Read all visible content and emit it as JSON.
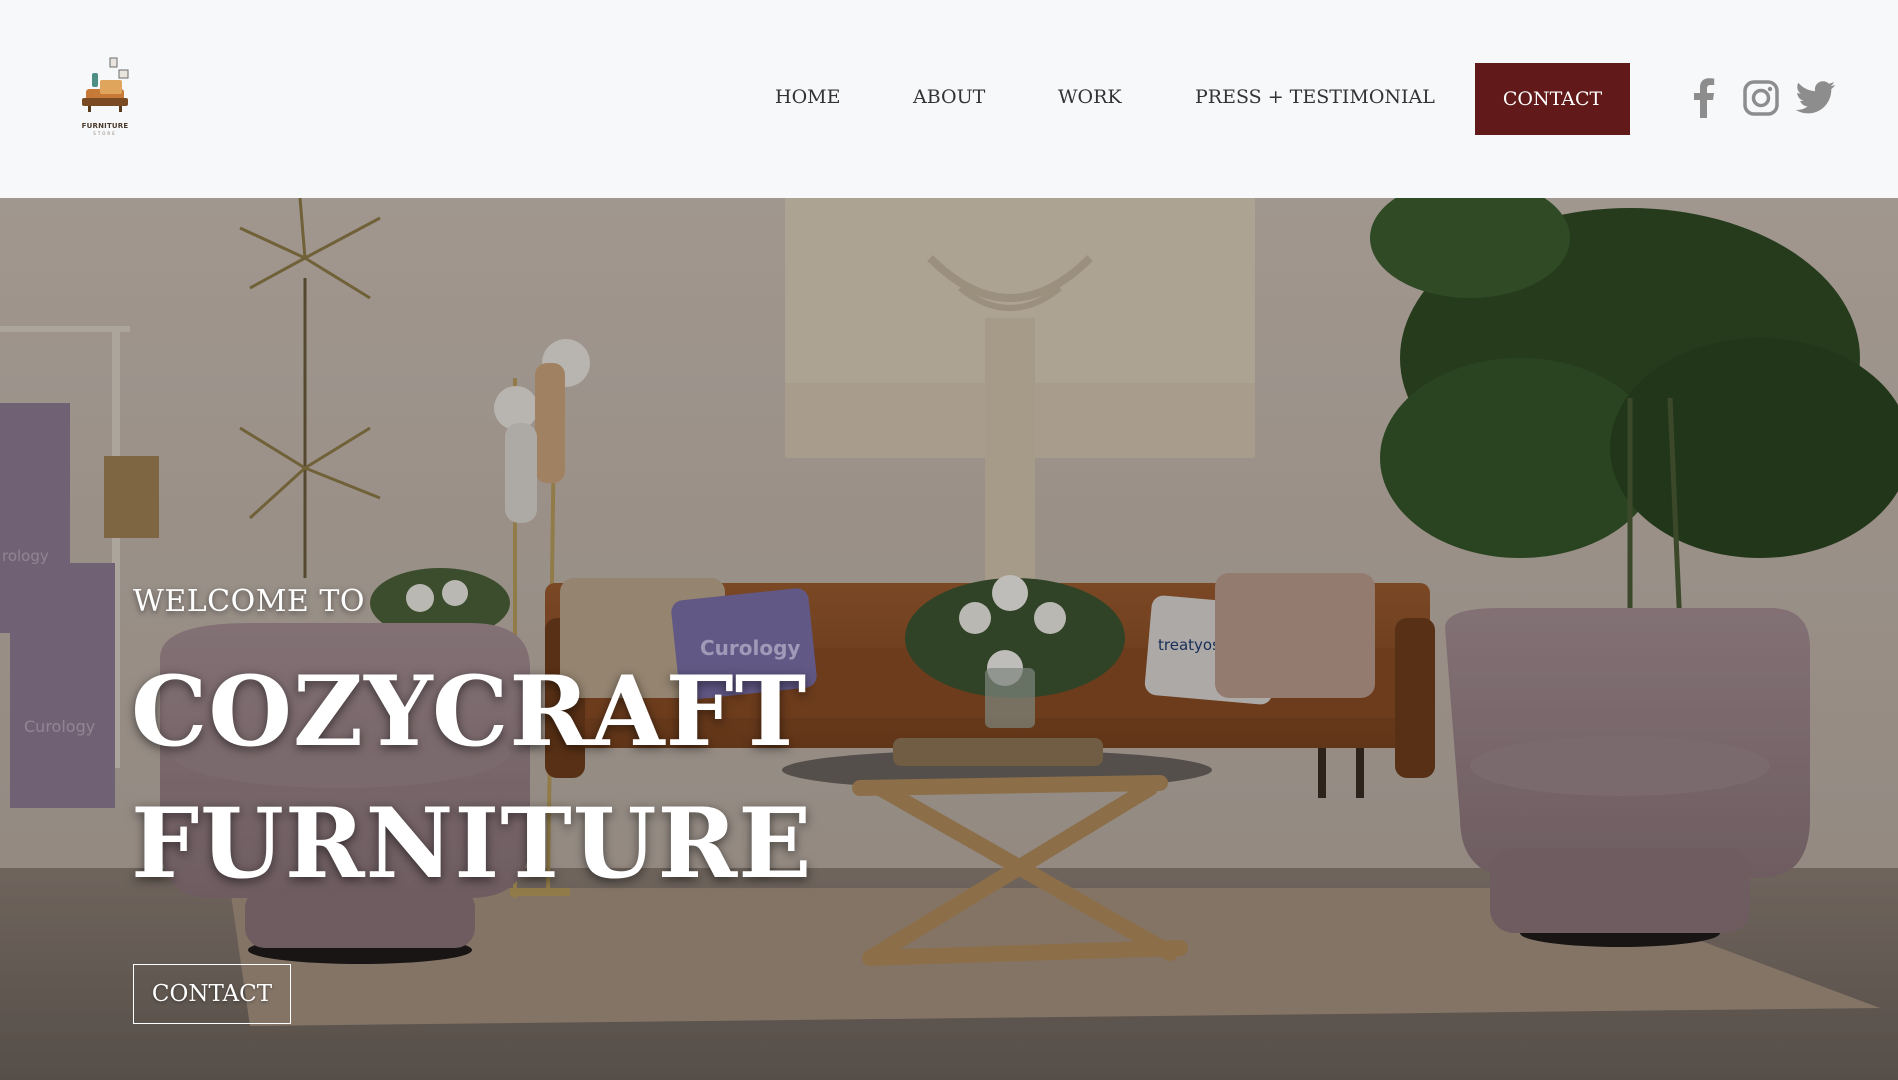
{
  "brand": {
    "logo_text": "FURNITURE",
    "logo_subtext": "STORE"
  },
  "nav": {
    "items": [
      {
        "label": "HOME"
      },
      {
        "label": "ABOUT"
      },
      {
        "label": "WORK"
      },
      {
        "label": "PRESS + TESTIMONIAL"
      }
    ],
    "contact_label": "CONTACT"
  },
  "social": {
    "icons": [
      "facebook-icon",
      "instagram-icon",
      "twitter-icon"
    ],
    "color": "#8d8d8d"
  },
  "hero": {
    "welcome": "WELCOME TO",
    "title_line1": "COZYCRAFT",
    "title_line2": "FURNITURE",
    "cta_label": "CONTACT",
    "pillow_text_1": "Curology",
    "pillow_text_2": "treatyoskin",
    "towel_text_1": "rology",
    "towel_text_2": "Curology"
  },
  "colors": {
    "header_bg": "#f7f8fa",
    "accent": "#611919",
    "nav_text": "#333333",
    "hero_text": "#ffffff"
  }
}
